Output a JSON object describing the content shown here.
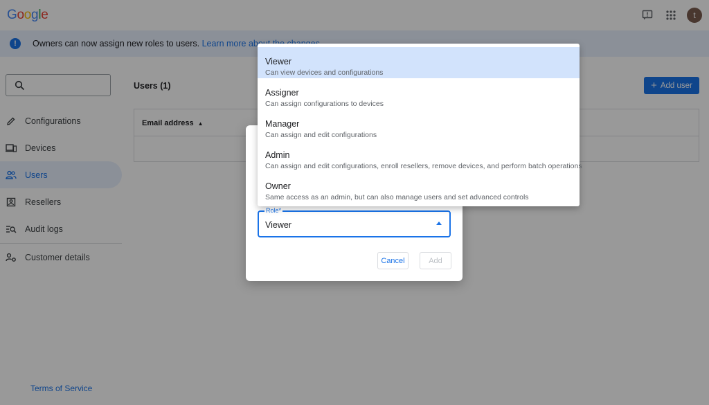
{
  "brand": {
    "logo_letters": [
      "G",
      "o",
      "o",
      "g",
      "l",
      "e"
    ]
  },
  "header": {
    "avatar_initial": "t",
    "feedback_icon": "feedback-icon",
    "apps_icon": "apps-grid-icon"
  },
  "banner": {
    "text": "Owners can now assign new roles to users. ",
    "link": "Learn more about the changes"
  },
  "sidebar": {
    "search_placeholder": "",
    "items": [
      {
        "label": "Configurations",
        "icon": "pencil-icon"
      },
      {
        "label": "Devices",
        "icon": "devices-icon"
      },
      {
        "label": "Users",
        "icon": "users-icon",
        "active": true
      },
      {
        "label": "Resellers",
        "icon": "reseller-icon"
      },
      {
        "label": "Audit logs",
        "icon": "audit-logs-icon"
      },
      {
        "label": "Customer details",
        "icon": "customer-settings-icon"
      }
    ],
    "terms": "Terms of Service"
  },
  "main": {
    "title": "Users (1)",
    "add_user": "Add user",
    "table": {
      "columns": [
        "Email address"
      ]
    }
  },
  "dialog": {
    "role_label": "Role*",
    "role_value": "Viewer",
    "cancel": "Cancel",
    "add": "Add"
  },
  "menu": {
    "options": [
      {
        "title": "Viewer",
        "desc": "Can view devices and configurations",
        "selected": true
      },
      {
        "title": "Assigner",
        "desc": "Can assign configurations to devices"
      },
      {
        "title": "Manager",
        "desc": "Can assign and edit configurations"
      },
      {
        "title": "Admin",
        "desc": "Can assign and edit configurations, enroll resellers, remove devices, and perform batch operations"
      },
      {
        "title": "Owner",
        "desc": "Same access as an admin, but can also manage users and set advanced controls"
      }
    ]
  },
  "colors": {
    "accent": "#1a73e8",
    "selected_option": "#d2e3fc",
    "banner": "#e8f0fe"
  }
}
